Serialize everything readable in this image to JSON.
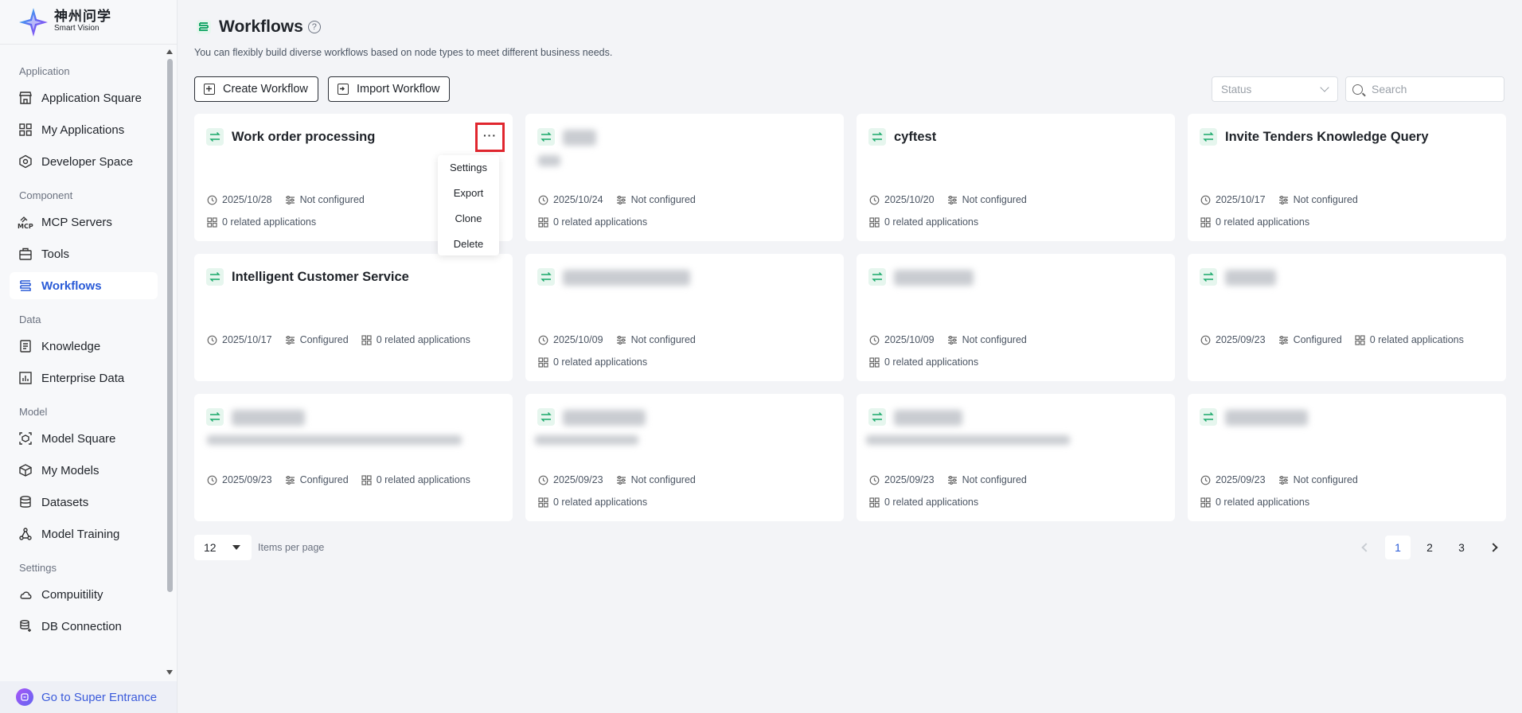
{
  "brand": {
    "cn": "神州问学",
    "en": "Smart Vision"
  },
  "sidebar": {
    "groups": [
      {
        "label": "Application",
        "items": [
          "Application Square",
          "My Applications",
          "Developer Space"
        ]
      },
      {
        "label": "Component",
        "items": [
          "MCP Servers",
          "Tools",
          "Workflows"
        ]
      },
      {
        "label": "Data",
        "items": [
          "Knowledge",
          "Enterprise Data"
        ]
      },
      {
        "label": "Model",
        "items": [
          "Model Square",
          "My Models",
          "Datasets",
          "Model Training"
        ]
      },
      {
        "label": "Settings",
        "items": [
          "Compuitility",
          "DB Connection"
        ]
      }
    ],
    "active": "Workflows",
    "mcp_badge": "MCP",
    "super_entrance": "Go to Super Entrance"
  },
  "header": {
    "title": "Workflows",
    "help_icon": "?",
    "subtitle": "You can flexibly build diverse workflows based on node types to meet different business needs."
  },
  "toolbar": {
    "create_label": "Create Workflow",
    "import_label": "Import Workflow",
    "status_placeholder": "Status",
    "search_placeholder": "Search"
  },
  "more_dots": "···",
  "context_menu": [
    "Settings",
    "Export",
    "Clone",
    "Delete"
  ],
  "cards": [
    {
      "name": "Work order processing",
      "date": "2025/10/28",
      "config": "Not configured",
      "related": "0 related applications"
    },
    {
      "name": "",
      "date": "2025/10/24",
      "config": "Not configured",
      "related": "0 related applications"
    },
    {
      "name": "cyftest",
      "date": "2025/10/20",
      "config": "Not configured",
      "related": "0 related applications"
    },
    {
      "name": "Invite Tenders Knowledge Query",
      "date": "2025/10/17",
      "config": "Not configured",
      "related": "0 related applications"
    },
    {
      "name": "Intelligent Customer Service",
      "date": "2025/10/17",
      "config": "Configured",
      "related": "0 related applications"
    },
    {
      "name": "",
      "date": "2025/10/09",
      "config": "Not configured",
      "related": "0 related applications"
    },
    {
      "name": "",
      "date": "2025/10/09",
      "config": "Not configured",
      "related": "0 related applications"
    },
    {
      "name": "",
      "date": "2025/09/23",
      "config": "Configured",
      "related": "0 related applications"
    },
    {
      "name": "",
      "date": "2025/09/23",
      "config": "Configured",
      "related": "0 related applications"
    },
    {
      "name": "",
      "date": "2025/09/23",
      "config": "Not configured",
      "related": "0 related applications"
    },
    {
      "name": "",
      "date": "2025/09/23",
      "config": "Not configured",
      "related": "0 related applications"
    },
    {
      "name": "",
      "date": "2025/09/23",
      "config": "Not configured",
      "related": "0 related applications"
    }
  ],
  "pagination": {
    "page_size": "12",
    "per_page_label": "Items per page",
    "pages": [
      "1",
      "2",
      "3"
    ],
    "current": "1"
  },
  "colors": {
    "accent": "#2a5bd7",
    "workflow_icon": "#1aa86a",
    "highlight": "#e0262e"
  }
}
